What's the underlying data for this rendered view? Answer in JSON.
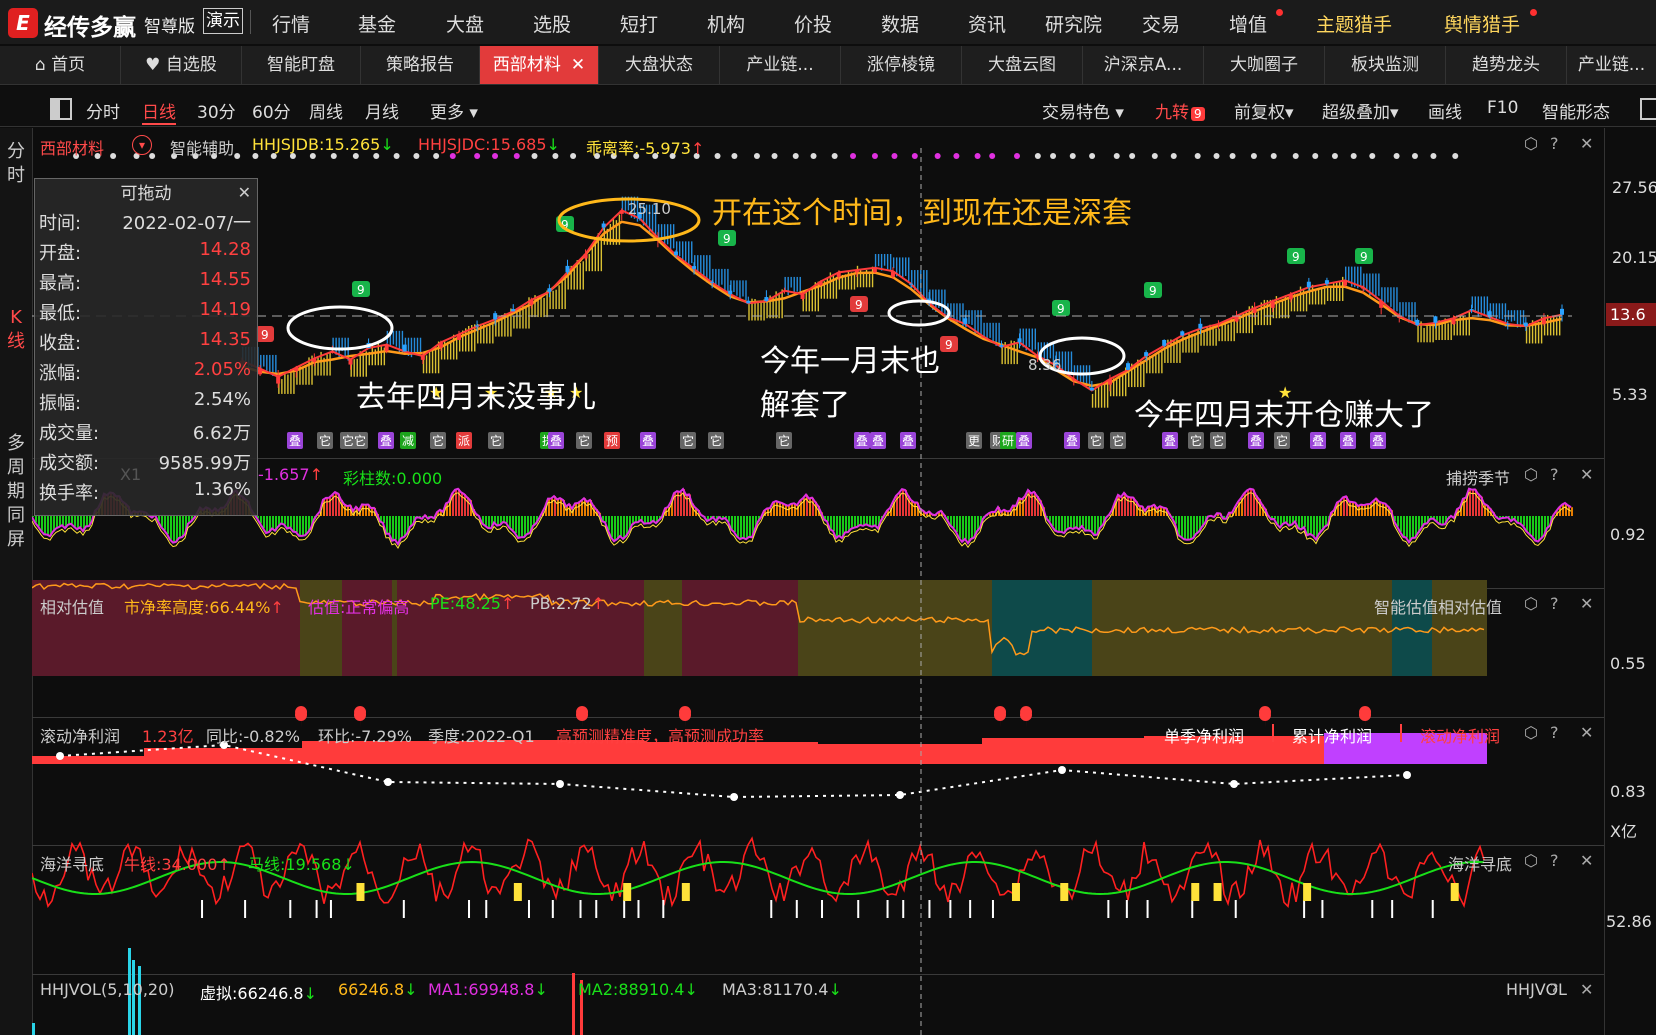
{
  "app": {
    "logo_char": "E",
    "name": "经传多赢",
    "edition": "智尊版",
    "demo": "演示"
  },
  "menu": [
    "行情",
    "基金",
    "大盘",
    "选股",
    "短打",
    "机构",
    "价投",
    "数据",
    "资讯",
    "研究院",
    "交易",
    "增值",
    "主题猎手",
    "舆情猎手"
  ],
  "tabs": [
    "首页",
    "自选股",
    "智能盯盘",
    "策略报告",
    "西部材料",
    "大盘状态",
    "产业链...",
    "涨停棱镜",
    "大盘云图",
    "沪深京A...",
    "大咖圈子",
    "板块监测",
    "趋势龙头",
    "产业链..."
  ],
  "toolbar": {
    "periods": [
      "分时",
      "日线",
      "30分",
      "60分",
      "周线",
      "月线"
    ],
    "more": "更多",
    "right": [
      "交易特色",
      "九转",
      "前复权",
      "超级叠加",
      "画线",
      "F10",
      "智能形态"
    ],
    "jiuzhuan_badge": "9"
  },
  "left_vertical": {
    "top": [
      "分",
      "时"
    ],
    "mid": [
      "K",
      "线"
    ],
    "bottom": [
      "多",
      "周",
      "期",
      "同",
      "屏"
    ]
  },
  "kline": {
    "stock": "西部材料",
    "assist": "智能辅助",
    "hhjsjdb": "HHJSJDB:15.265",
    "hhjsjdc": "HHJSJDC:15.685",
    "deviation": "乖离率:-5.973",
    "axis": [
      "27.56",
      "20.15",
      "13.6",
      "5.33"
    ],
    "max_label": "25.10",
    "min_label": "8.36"
  },
  "infobox": {
    "title": "可拖动",
    "rows": [
      {
        "label": "时间:",
        "value": "2022-02-07/一",
        "color": "#dddddd"
      },
      {
        "label": "开盘:",
        "value": "14.28",
        "color": "#ff4040"
      },
      {
        "label": "最高:",
        "value": "14.55",
        "color": "#ff4040"
      },
      {
        "label": "最低:",
        "value": "14.19",
        "color": "#ff4040"
      },
      {
        "label": "收盘:",
        "value": "14.35",
        "color": "#ff4040"
      },
      {
        "label": "涨幅:",
        "value": "2.05%",
        "color": "#ff4040"
      },
      {
        "label": "振幅:",
        "value": "2.54%",
        "color": "#dddddd"
      },
      {
        "label": "成交量:",
        "value": "6.62万",
        "color": "#dddddd"
      },
      {
        "label": "成交额:",
        "value": "9585.99万",
        "color": "#dddddd"
      },
      {
        "label": "换手率:",
        "value": "1.36%",
        "color": "#dddddd"
      }
    ]
  },
  "annotations": {
    "a1": "开在这个时间，到现在还是深套",
    "a2": "去年四月末没事儿",
    "a3a": "今年一月末也",
    "a3b": "解套了",
    "a4": "今年四月末开仓赚大了"
  },
  "panel2": {
    "title_tail": "-1.657",
    "caizhu": "彩柱数:0.000",
    "name": "捕捞季节",
    "axis": "0.92",
    "prefix": "X1"
  },
  "panel3": {
    "title": "相对估值",
    "pb_height": "市净率高度:66.44%",
    "valuation": "估值:正常偏高",
    "pe": "PE:48.25",
    "pb": "PB:2.72",
    "name": "智能估值相对估值",
    "axis": "0.55"
  },
  "panel4": {
    "title": "滚动净利润",
    "value": "1.23亿",
    "yoy": "同比:-0.82%",
    "qoq": "环比:-7.29%",
    "quarter": "季度:2022-Q1",
    "note": "高预测精准度，高预测成功率",
    "tabs": [
      "单季净利润",
      "累计净利润",
      "滚动净利润"
    ],
    "axis": "0.83",
    "unit": "X亿"
  },
  "panel5": {
    "title": "海洋寻底",
    "bull": "牛线:34.000",
    "horse": "马线:19.568",
    "name": "海洋寻底",
    "axis": "52.86"
  },
  "panel6": {
    "title": "HHJVOL(5,10,20)",
    "virtual": "虚拟:66246.8",
    "v2": "66246.8",
    "ma1": "MA1:69948.8",
    "ma2": "MA2:88910.4",
    "ma3": "MA3:81170.4",
    "name": "HHJVOL"
  },
  "signals": [
    "叠",
    "它",
    "它它",
    "叠",
    "减",
    "它",
    "派",
    "它",
    "提",
    "叠",
    "它",
    "预",
    "叠",
    "它",
    "它",
    "它",
    "叠",
    "叠",
    "叠",
    "更",
    "财",
    "研",
    "叠",
    "叠",
    "它",
    "它",
    "叠",
    "它",
    "它",
    "叠",
    "它",
    "叠",
    "叠",
    "叠"
  ],
  "colors": {
    "up": "#ff3b3b",
    "down": "#2aa2ff",
    "yellow": "#ffe23a",
    "green": "#19e019",
    "orange": "#ff9a1a",
    "magenta": "#e030e0",
    "gold": "#ffb81a"
  },
  "chart_data": {
    "type": "line",
    "price_close": [
      11.2,
      10.5,
      9.8,
      10.6,
      11.4,
      12.0,
      11.3,
      12.3,
      12.6,
      12.0,
      11.6,
      12.8,
      13.5,
      14.2,
      14.8,
      15.5,
      16.5,
      17.2,
      18.9,
      20.5,
      22.8,
      24.3,
      23.6,
      21.9,
      20.4,
      19.2,
      18.0,
      17.0,
      16.2,
      16.4,
      17.3,
      17.0,
      18.1,
      18.9,
      19.1,
      19.3,
      19.0,
      17.9,
      16.2,
      15.0,
      14.4,
      13.3,
      12.4,
      12.8,
      11.6,
      10.8,
      9.6,
      8.6,
      9.6,
      10.4,
      11.6,
      12.5,
      13.4,
      14.0,
      14.4,
      15.1,
      15.8,
      16.4,
      17.0,
      17.6,
      17.9,
      18.2,
      17.6,
      16.4,
      15.1,
      14.3,
      14.5,
      14.9,
      15.6,
      15.0,
      14.4,
      14.2,
      14.9,
      15.2
    ]
  }
}
